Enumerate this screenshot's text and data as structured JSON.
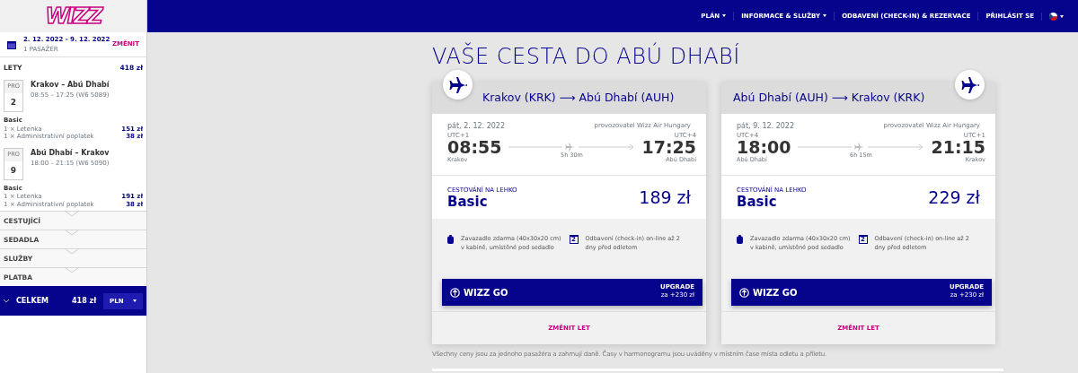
{
  "logo": "WIZZ",
  "nav": [
    {
      "label": "PLÁN",
      "dropdown": true
    },
    {
      "label": "INFORMACE & SLUŽBY",
      "dropdown": true
    },
    {
      "label": "ODBAVENÍ (CHECK-IN) & REZERVACE",
      "dropdown": false
    },
    {
      "label": "PŘIHLÁSIT SE",
      "dropdown": false
    }
  ],
  "sidebar": {
    "dates": "2. 12. 2022 - 9. 12. 2022",
    "passengers": "1 PASAŽÉR",
    "change": "ZMĚNIT",
    "section": "LETY",
    "section_total": "418 zł",
    "flights": [
      {
        "weekday": "PRO",
        "day": "2",
        "route": "Krakov – Abú Dhabí",
        "times": "08:55 – 17:25 (W6 5089)",
        "fare": "Basic",
        "items": [
          {
            "label": "1 × Letenka",
            "price": "151 zł"
          },
          {
            "label": "1 × Administrativní poplatek",
            "price": "38 zł"
          }
        ]
      },
      {
        "weekday": "PRO",
        "day": "9",
        "route": "Abú Dhabí – Krakov",
        "times": "18:00 – 21:15 (W6 5090)",
        "fare": "Basic",
        "items": [
          {
            "label": "1 × Letenka",
            "price": "191 zł"
          },
          {
            "label": "1 × Administrativní poplatek",
            "price": "38 zł"
          }
        ]
      }
    ],
    "sections": [
      "CESTUJÍCÍ",
      "SEDADLA",
      "SLUŽBY",
      "PLATBA"
    ],
    "total": {
      "label": "CELKEM",
      "amount": "418 zł",
      "currency": "PLN"
    }
  },
  "title": "VAŠE CESTA DO ABÚ DHABÍ",
  "cards": [
    {
      "badge_left": true,
      "from": "Krakov (KRK)",
      "arrow": "⟶",
      "to": "Abú Dhabí (AUH)",
      "date": "pát, 2. 12. 2022",
      "operator": "provozovatel Wizz Air Hungary",
      "dep_tz": "UTC+1",
      "dep_time": "08:55",
      "dep_city": "Krakov",
      "duration": "5h 30m",
      "arr_tz": "UTC+4",
      "arr_time": "17:25",
      "arr_city": "Abú Dhabí",
      "fare_label": "CESTOVÁNÍ NA LEHKO",
      "fare": "Basic",
      "price": "189 zł",
      "perks": [
        {
          "kind": "bag",
          "text": "Zavazadlo zdarma (40x30x20 cm) v kabině, umístěné pod sedadlo"
        },
        {
          "kind": "calendar",
          "icon_text": "2",
          "text": "Odbavení (check-in) on-line až 2 dny před odletem"
        }
      ],
      "upgrade": {
        "name": "WIZZ GO",
        "label": "UPGRADE",
        "price": "za +230 zł"
      },
      "change": "ZMĚNIT LET"
    },
    {
      "badge_left": false,
      "from": "Abú Dhabí (AUH)",
      "arrow": "⟶",
      "to": "Krakov (KRK)",
      "date": "pát, 9. 12. 2022",
      "operator": "provozovatel Wizz Air Hungary",
      "dep_tz": "UTC+4",
      "dep_time": "18:00",
      "dep_city": "Abú Dhabí",
      "duration": "6h 15m",
      "arr_tz": "UTC+1",
      "arr_time": "21:15",
      "arr_city": "Krakov",
      "fare_label": "CESTOVÁNÍ NA LEHKO",
      "fare": "Basic",
      "price": "229 zł",
      "perks": [
        {
          "kind": "bag",
          "text": "Zavazadlo zdarma (40x30x20 cm) v kabině, umístěné pod sedadlo"
        },
        {
          "kind": "calendar",
          "icon_text": "2",
          "text": "Odbavení (check-in) on-line až 2 dny před odletem"
        }
      ],
      "upgrade": {
        "name": "WIZZ GO",
        "label": "UPGRADE",
        "price": "za +230 zł"
      },
      "change": "ZMĚNIT LET"
    }
  ],
  "footnote": "Všechny ceny jsou za jednoho pasažéra a zahrnují daně. Časy v harmonogramu jsou uváděny v místním čase místa odletu a příletu."
}
